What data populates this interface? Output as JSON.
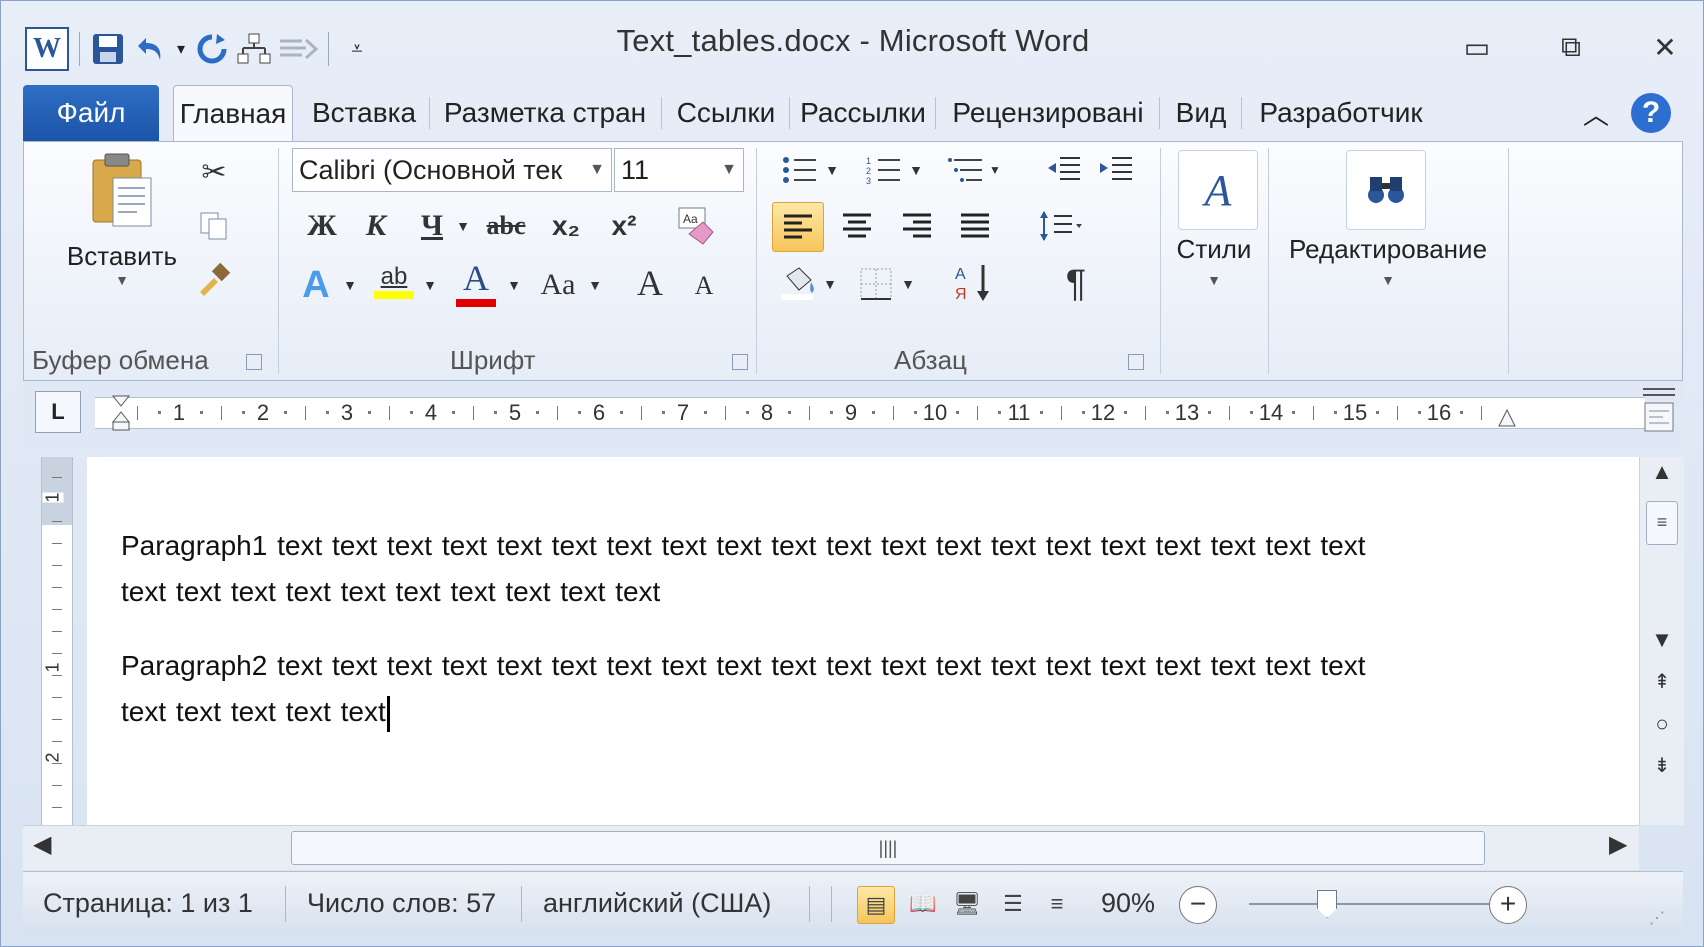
{
  "window": {
    "title": "Text_tables.docx - Microsoft Word",
    "controls": {
      "minimize": "▭",
      "restore": "⧉",
      "close": "✕"
    }
  },
  "qat": {
    "word_logo": "W",
    "icons": [
      "save-icon",
      "undo-icon",
      "redo-icon",
      "tree-icon",
      "send-icon",
      "customize-icon"
    ]
  },
  "tabs": [
    {
      "label": "Файл"
    },
    {
      "label": "Главная"
    },
    {
      "label": "Вставка"
    },
    {
      "label": "Разметка стран"
    },
    {
      "label": "Ссылки"
    },
    {
      "label": "Рассылки"
    },
    {
      "label": "Рецензировані"
    },
    {
      "label": "Вид"
    },
    {
      "label": "Разработчик"
    }
  ],
  "help": "?",
  "ribbon": {
    "clipboard": {
      "paste_label": "Вставить",
      "group_label": "Буфер обмена"
    },
    "font": {
      "font_name": "Calibri (Основной тек",
      "font_size": "11",
      "bold": "Ж",
      "italic": "К",
      "underline": "Ч",
      "strike": "abc",
      "subscript": "x₂",
      "superscript": "x²",
      "text_effects": "A",
      "highlight": "ab",
      "font_color": "A",
      "change_case": "Aa",
      "grow": "A",
      "shrink": "A",
      "group_label": "Шрифт"
    },
    "paragraph": {
      "group_label": "Абзац",
      "pilcrow": "¶"
    },
    "styles": {
      "label": "Стили",
      "icon_glyph": "A"
    },
    "editing": {
      "label": "Редактирование",
      "icon_glyph": "🔭"
    }
  },
  "ruler": {
    "numbers": [
      "1",
      "2",
      "3",
      "4",
      "5",
      "6",
      "7",
      "8",
      "9",
      "10",
      "11",
      "12",
      "13",
      "14",
      "15",
      "16"
    ],
    "corner": "L",
    "vertical_numbers": [
      "1",
      "1",
      "2"
    ]
  },
  "document": {
    "paragraph1_line1": "Paragraph1 text text text text text text text text text text text text text text text text text text text text",
    "paragraph1_line2": "text text text text text text text text text text",
    "paragraph2_line1": "Paragraph2 text text text text text text text text text text text text text text text text text text text text",
    "paragraph2_line2": "text text text text text"
  },
  "statusbar": {
    "page": "Страница: 1 из 1",
    "words": "Число слов: 57",
    "language": "английский (США)",
    "zoom": "90%",
    "zoom_minus": "−",
    "zoom_plus": "+"
  },
  "scroll": {
    "grip": "||||",
    "vs_grip": "≡"
  },
  "colors": {
    "file_tab": "#1c54a8",
    "accent": "#2b579a",
    "active_highlight": "#f6c55b",
    "font_color_bar": "#e00000",
    "highlight_bar": "#ffff00"
  }
}
